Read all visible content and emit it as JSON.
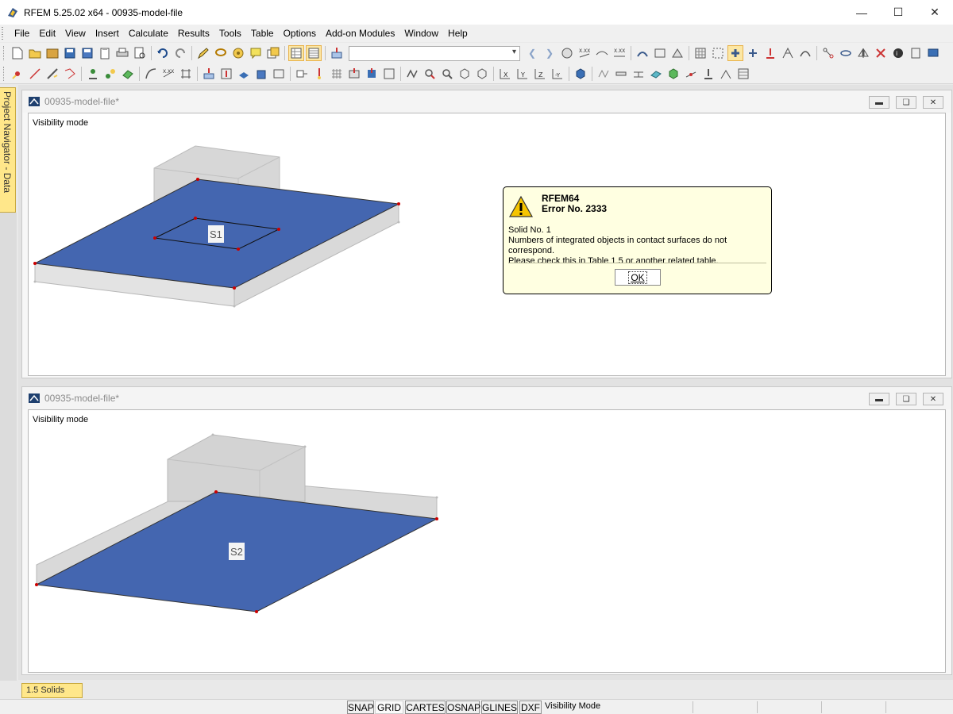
{
  "app": {
    "title": "RFEM 5.25.02 x64 - 00935-model-file",
    "window_controls": [
      "minimize",
      "maximize",
      "close"
    ]
  },
  "menu": {
    "items": [
      "File",
      "Edit",
      "View",
      "Insert",
      "Calculate",
      "Results",
      "Tools",
      "Table",
      "Options",
      "Add-on Modules",
      "Window",
      "Help"
    ]
  },
  "toolbar": {
    "combo_value": ""
  },
  "navigator": {
    "tab_label": "Project Navigator - Data"
  },
  "windows": [
    {
      "title": "00935-model-file*",
      "mode_label": "Visibility mode",
      "surface_label": "S1"
    },
    {
      "title": "00935-model-file*",
      "mode_label": "Visibility mode",
      "surface_label": "S2"
    }
  ],
  "dialog": {
    "title_line1": "RFEM64",
    "title_line2": "Error No. 2333",
    "body_line1": "Solid No. 1",
    "body_line2": "Numbers of integrated objects in contact surfaces do not correspond.",
    "body_line3": "Please check this in Table 1.5 or another related table.",
    "ok_label": "OK"
  },
  "bottom_tab": {
    "label": "1.5 Solids"
  },
  "statusbar": {
    "buttons": [
      "SNAP",
      "GRID",
      "CARTES",
      "OSNAP",
      "GLINES",
      "DXF"
    ],
    "mode_text": "Visibility Mode"
  },
  "colors": {
    "surface_blue": "#4466b0",
    "dialog_bg": "#ffffe1",
    "tab_yellow": "#ffe78a"
  }
}
